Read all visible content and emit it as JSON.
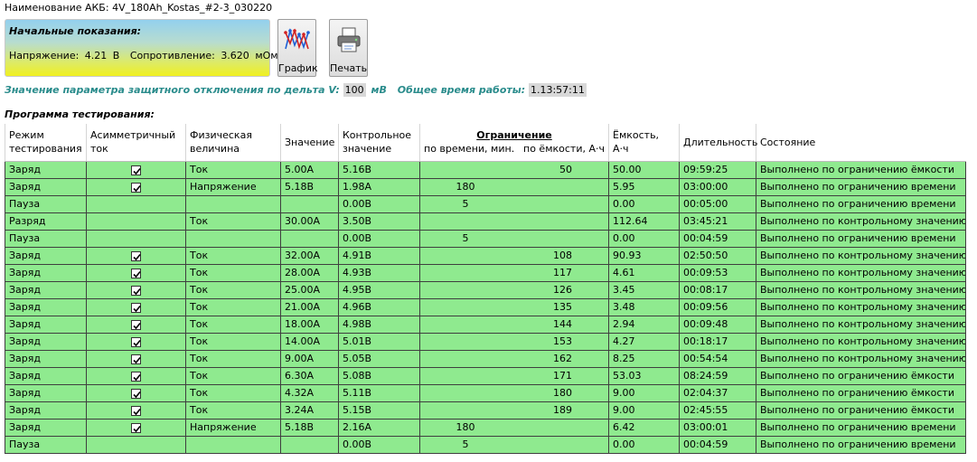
{
  "battery": {
    "label": "Наименование АКБ:",
    "name": "4V_180Ah_Kostas_#2-3_030220"
  },
  "initial_readings": {
    "title": "Начальные показания:",
    "voltage_label": "Напряжение:",
    "voltage_value": "4.21",
    "voltage_unit": "В",
    "resistance_label": "Сопротивление:",
    "resistance_value": "3.620",
    "resistance_unit": "мОм"
  },
  "toolbar": {
    "chart_label": "График",
    "print_label": "Печать",
    "chart_icon": "chart-icon",
    "print_icon": "printer-icon"
  },
  "params": {
    "delta_label": "Значение параметра защитного отключения по дельта V:",
    "delta_value": "100",
    "delta_unit": "мВ",
    "total_label": "Общее время работы:",
    "total_value": "1.13:57:11"
  },
  "program_title": "Программа тестирования:",
  "table": {
    "headers": {
      "mode": [
        "Режим",
        "тестирования"
      ],
      "asym": [
        "Асимметричный",
        "ток"
      ],
      "phys": [
        "Физическая",
        "величина"
      ],
      "value": "Значение",
      "control": [
        "Контрольное",
        "значение"
      ],
      "limit": "Ограничение",
      "limit_time": "по времени, мин.",
      "limit_capacity": "по ёмкости, А·ч",
      "capacity": "Ёмкость, А·ч",
      "duration": "Длительность",
      "state": "Состояние"
    },
    "rows": [
      {
        "mode": "Заряд",
        "asym": true,
        "phys": "Ток",
        "value": "5.00A",
        "control": "5.16В",
        "limit_time": "",
        "limit_cap": "50",
        "capacity": "50.00",
        "duration": "09:59:25",
        "state": "Выполнено по ограничению ёмкости"
      },
      {
        "mode": "Заряд",
        "asym": true,
        "phys": "Напряжение",
        "value": "5.18В",
        "control": "1.98A",
        "limit_time": "180",
        "limit_cap": "",
        "capacity": "5.95",
        "duration": "03:00:00",
        "state": "Выполнено по ограничению времени"
      },
      {
        "mode": "Пауза",
        "asym": false,
        "phys": "",
        "value": "",
        "control": "0.00В",
        "limit_time": "5",
        "limit_cap": "",
        "capacity": "0.00",
        "duration": "00:05:00",
        "state": "Выполнено по ограничению времени"
      },
      {
        "mode": "Разряд",
        "asym": false,
        "phys": "Ток",
        "value": "30.00A",
        "control": "3.50В",
        "limit_time": "",
        "limit_cap": "",
        "capacity": "112.64",
        "duration": "03:45:21",
        "state": "Выполнено по контрольному значению"
      },
      {
        "mode": "Пауза",
        "asym": false,
        "phys": "",
        "value": "",
        "control": "0.00В",
        "limit_time": "5",
        "limit_cap": "",
        "capacity": "0.00",
        "duration": "00:04:59",
        "state": "Выполнено по ограничению времени"
      },
      {
        "mode": "Заряд",
        "asym": true,
        "phys": "Ток",
        "value": "32.00A",
        "control": "4.91В",
        "limit_time": "",
        "limit_cap": "108",
        "capacity": "90.93",
        "duration": "02:50:50",
        "state": "Выполнено по контрольному значению"
      },
      {
        "mode": "Заряд",
        "asym": true,
        "phys": "Ток",
        "value": "28.00A",
        "control": "4.93В",
        "limit_time": "",
        "limit_cap": "117",
        "capacity": "4.61",
        "duration": "00:09:53",
        "state": "Выполнено по контрольному значению"
      },
      {
        "mode": "Заряд",
        "asym": true,
        "phys": "Ток",
        "value": "25.00A",
        "control": "4.95В",
        "limit_time": "",
        "limit_cap": "126",
        "capacity": "3.45",
        "duration": "00:08:17",
        "state": "Выполнено по контрольному значению"
      },
      {
        "mode": "Заряд",
        "asym": true,
        "phys": "Ток",
        "value": "21.00A",
        "control": "4.96В",
        "limit_time": "",
        "limit_cap": "135",
        "capacity": "3.48",
        "duration": "00:09:56",
        "state": "Выполнено по контрольному значению"
      },
      {
        "mode": "Заряд",
        "asym": true,
        "phys": "Ток",
        "value": "18.00A",
        "control": "4.98В",
        "limit_time": "",
        "limit_cap": "144",
        "capacity": "2.94",
        "duration": "00:09:48",
        "state": "Выполнено по контрольному значению"
      },
      {
        "mode": "Заряд",
        "asym": true,
        "phys": "Ток",
        "value": "14.00A",
        "control": "5.01В",
        "limit_time": "",
        "limit_cap": "153",
        "capacity": "4.27",
        "duration": "00:18:17",
        "state": "Выполнено по контрольному значению"
      },
      {
        "mode": "Заряд",
        "asym": true,
        "phys": "Ток",
        "value": "9.00A",
        "control": "5.05В",
        "limit_time": "",
        "limit_cap": "162",
        "capacity": "8.25",
        "duration": "00:54:54",
        "state": "Выполнено по контрольному значению"
      },
      {
        "mode": "Заряд",
        "asym": true,
        "phys": "Ток",
        "value": "6.30A",
        "control": "5.08В",
        "limit_time": "",
        "limit_cap": "171",
        "capacity": "53.03",
        "duration": "08:24:59",
        "state": "Выполнено по ограничению ёмкости"
      },
      {
        "mode": "Заряд",
        "asym": true,
        "phys": "Ток",
        "value": "4.32A",
        "control": "5.11В",
        "limit_time": "",
        "limit_cap": "180",
        "capacity": "9.00",
        "duration": "02:04:37",
        "state": "Выполнено по ограничению ёмкости"
      },
      {
        "mode": "Заряд",
        "asym": true,
        "phys": "Ток",
        "value": "3.24A",
        "control": "5.15В",
        "limit_time": "",
        "limit_cap": "189",
        "capacity": "9.00",
        "duration": "02:45:55",
        "state": "Выполнено по ограничению ёмкости"
      },
      {
        "mode": "Заряд",
        "asym": true,
        "phys": "Напряжение",
        "value": "5.18В",
        "control": "2.16A",
        "limit_time": "180",
        "limit_cap": "",
        "capacity": "6.42",
        "duration": "03:00:01",
        "state": "Выполнено по ограничению времени"
      },
      {
        "mode": "Пауза",
        "asym": false,
        "phys": "",
        "value": "",
        "control": "0.00В",
        "limit_time": "5",
        "limit_cap": "",
        "capacity": "0.00",
        "duration": "00:04:59",
        "state": "Выполнено по ограничению времени"
      }
    ]
  }
}
